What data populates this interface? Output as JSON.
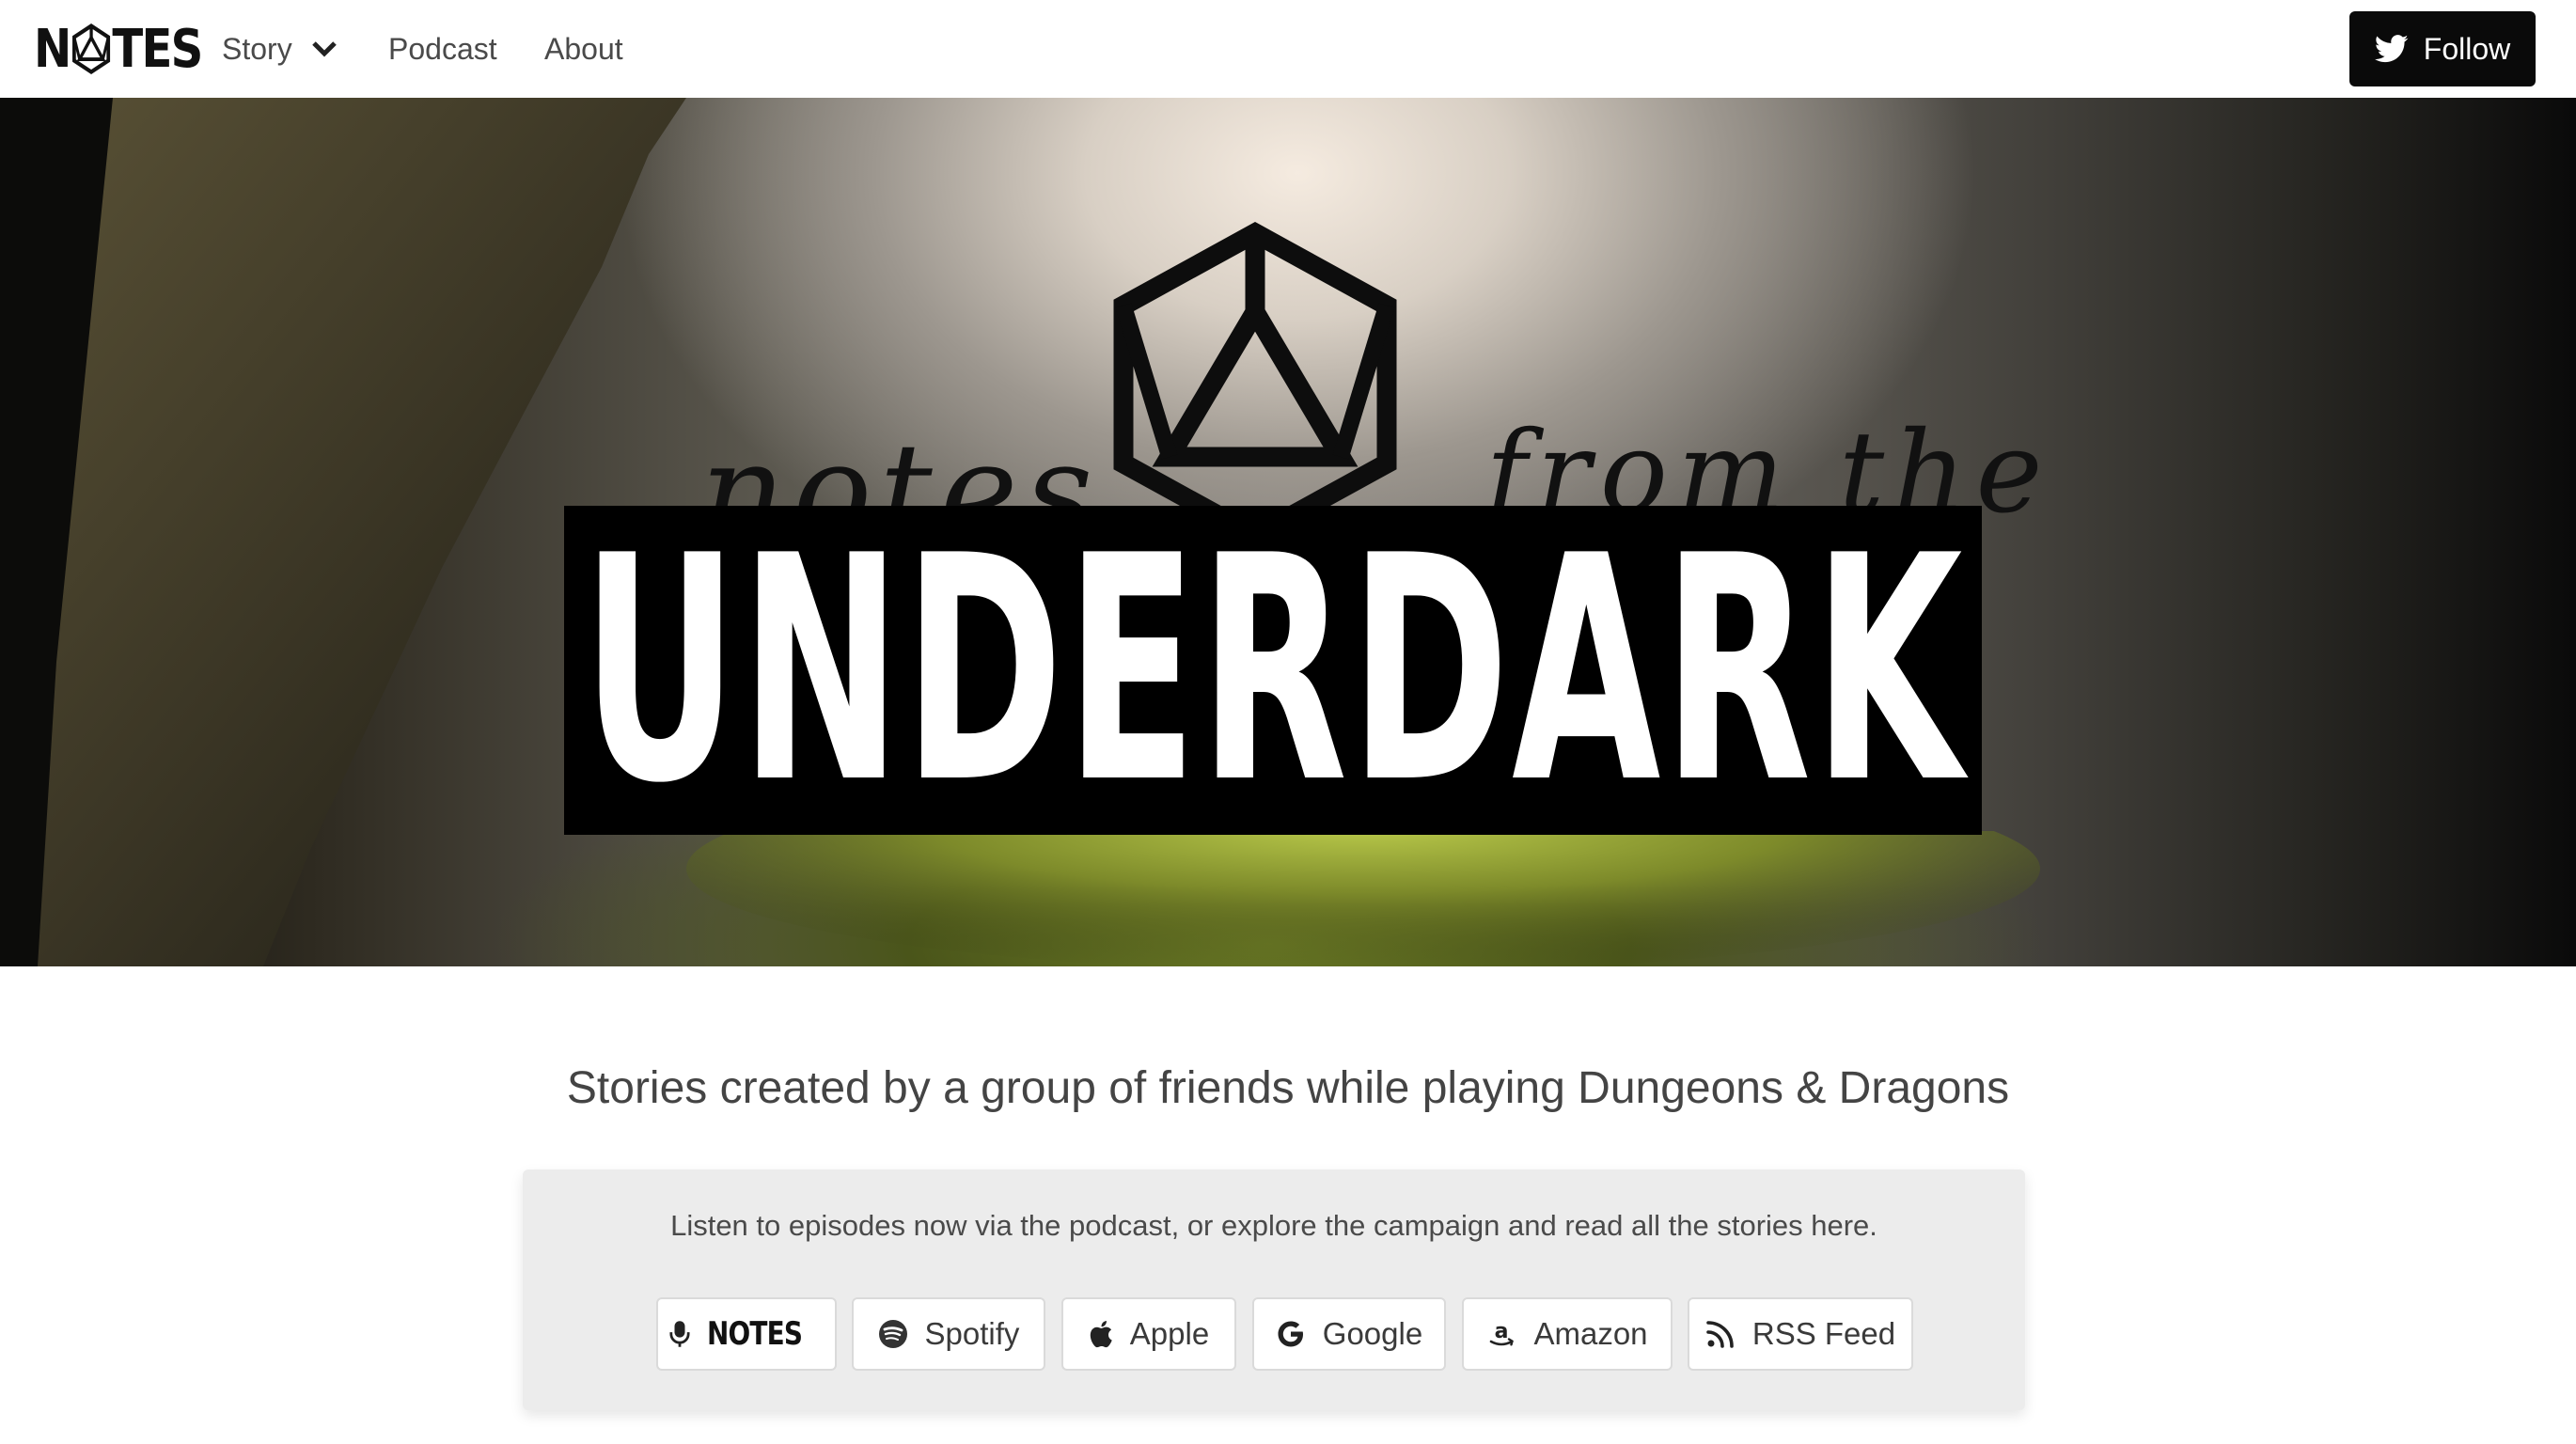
{
  "navbar": {
    "brand": "NOTES",
    "items": [
      {
        "label": "Story",
        "has_dropdown": true
      },
      {
        "label": "Podcast"
      },
      {
        "label": "About"
      }
    ],
    "follow_label": "Follow"
  },
  "hero": {
    "script_left": "notes",
    "script_right": "from the",
    "title": "UNDERDARK"
  },
  "tagline": "Stories created by a group of friends while playing Dungeons & Dragons",
  "listen": {
    "text": "Listen to episodes now via the podcast, or explore the campaign and read all the stories here.",
    "buttons": [
      {
        "label": "NOTES",
        "icon": "microphone-icon"
      },
      {
        "label": "Spotify",
        "icon": "spotify-icon"
      },
      {
        "label": "Apple",
        "icon": "apple-icon"
      },
      {
        "label": "Google",
        "icon": "google-icon"
      },
      {
        "label": "Amazon",
        "icon": "amazon-icon"
      },
      {
        "label": "RSS Feed",
        "icon": "rss-icon"
      }
    ]
  },
  "colors": {
    "follow_bg": "#0a0a0a",
    "card_bg": "#ececec",
    "title_bar": "#000000"
  }
}
